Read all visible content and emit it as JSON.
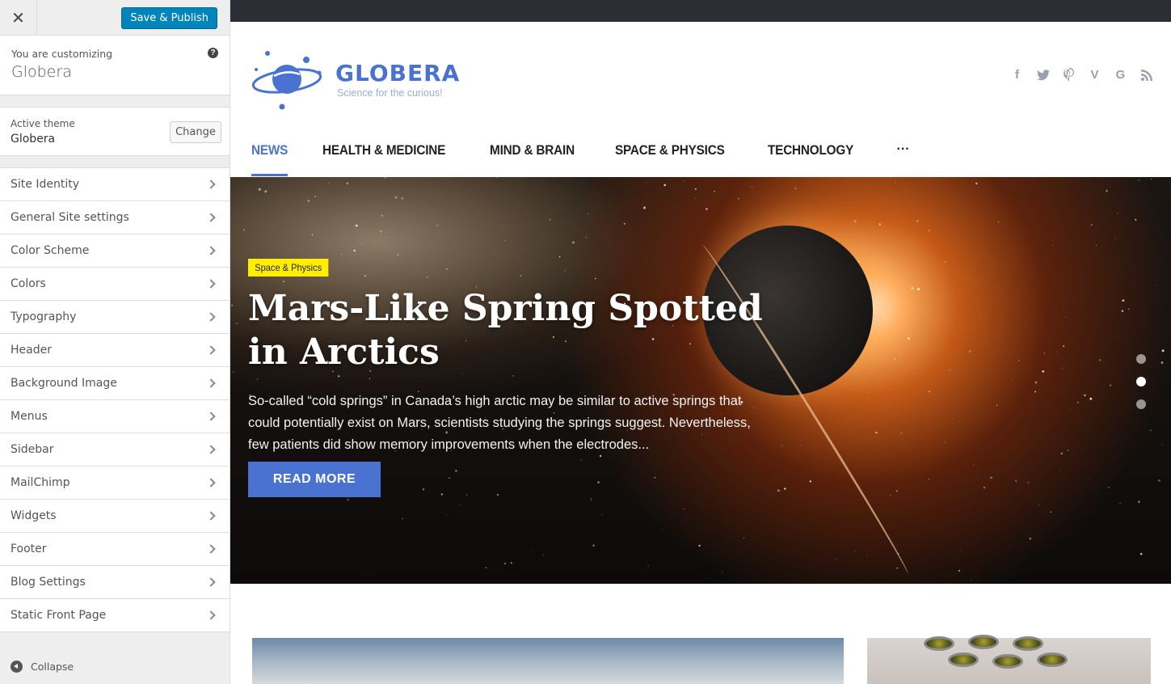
{
  "customizer": {
    "close_icon": "close-icon",
    "save_label": "Save & Publish",
    "customizing_label": "You are customizing",
    "site_name": "Globera",
    "help_icon": "help-icon",
    "active_theme_label": "Active theme",
    "active_theme_name": "Globera",
    "change_label": "Change",
    "sections": [
      {
        "label": "Site Identity"
      },
      {
        "label": "General Site settings"
      },
      {
        "label": "Color Scheme"
      },
      {
        "label": "Colors"
      },
      {
        "label": "Typography"
      },
      {
        "label": "Header"
      },
      {
        "label": "Background Image"
      },
      {
        "label": "Menus"
      },
      {
        "label": "Sidebar"
      },
      {
        "label": "MailChimp"
      },
      {
        "label": "Widgets"
      },
      {
        "label": "Footer"
      },
      {
        "label": "Blog Settings"
      },
      {
        "label": "Static Front Page"
      }
    ],
    "collapse_label": "Collapse",
    "accent_color": "#0085ba"
  },
  "site": {
    "logo_title": "GLOBERA",
    "tagline": "Science for the curious!",
    "brand_color": "#4a72d1",
    "social_icons": [
      "facebook-icon",
      "twitter-icon",
      "pinterest-icon",
      "vimeo-icon",
      "google-icon",
      "rss-icon"
    ],
    "nav": [
      {
        "label": "NEWS",
        "active": true
      },
      {
        "label": "HEALTH & MEDICINE"
      },
      {
        "label": "MIND & BRAIN"
      },
      {
        "label": "SPACE & PHYSICS"
      },
      {
        "label": "TECHNOLOGY"
      }
    ],
    "nav_more": "···",
    "hero": {
      "category": "Space & Physics",
      "title": "Mars-Like Spring Spotted in Arctics",
      "excerpt": "So-called “cold springs” in Canada’s high arctic may be similar to active springs that could potentially exist on Mars, scientists studying the springs suggest. Nevertheless, few patients did show memory improvements when the electrodes...",
      "cta": "READ MORE",
      "slides": 3,
      "active_slide": 2
    }
  }
}
